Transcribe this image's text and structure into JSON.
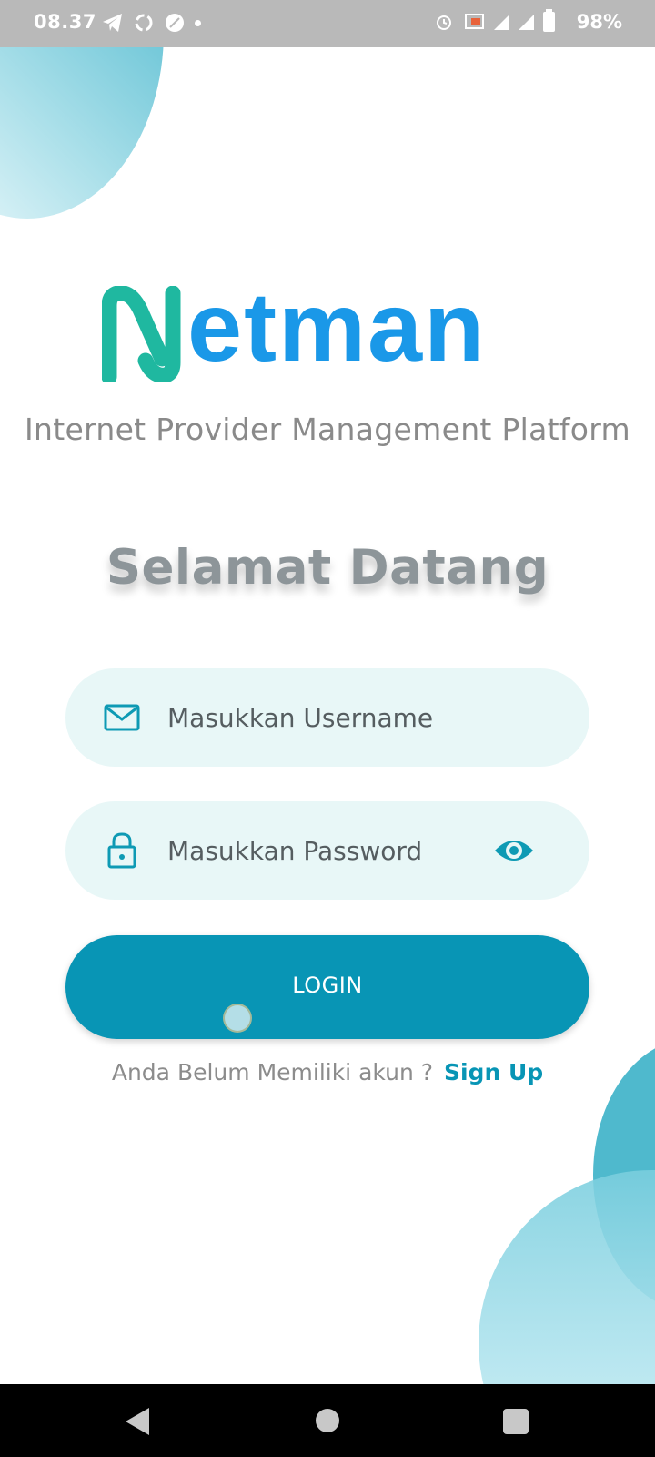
{
  "status_bar": {
    "time": "08.37",
    "battery": "98%",
    "left_icons": [
      "telegram-icon",
      "sync-icon",
      "leaf-icon",
      "dot-icon"
    ],
    "right_icons": [
      "alarm-icon",
      "cast-icon",
      "signal-icon",
      "signal-icon",
      "battery-icon"
    ]
  },
  "logo": {
    "initial": "N",
    "rest": "etman",
    "colors": {
      "initial": "#1fb8a0",
      "word": "#1a98e8"
    }
  },
  "tagline": "Internet Provider Management Platform",
  "welcome": "Selamat Datang",
  "form": {
    "username": {
      "placeholder": "Masukkan Username",
      "value": "",
      "icon": "mail-icon"
    },
    "password": {
      "placeholder": "Masukkan Password",
      "value": "",
      "icon": "lock-icon",
      "toggle_icon": "eye-icon"
    },
    "login_label": "LOGIN",
    "signup_prompt": "Anda Belum Memiliki akun ?",
    "signup_link": "Sign Up"
  },
  "nav_bar": {
    "buttons": [
      "back-icon",
      "home-icon",
      "recents-icon"
    ]
  },
  "colors": {
    "accent": "#0895b5",
    "field_bg": "#e8f7f7",
    "heading": "#8d9599"
  }
}
